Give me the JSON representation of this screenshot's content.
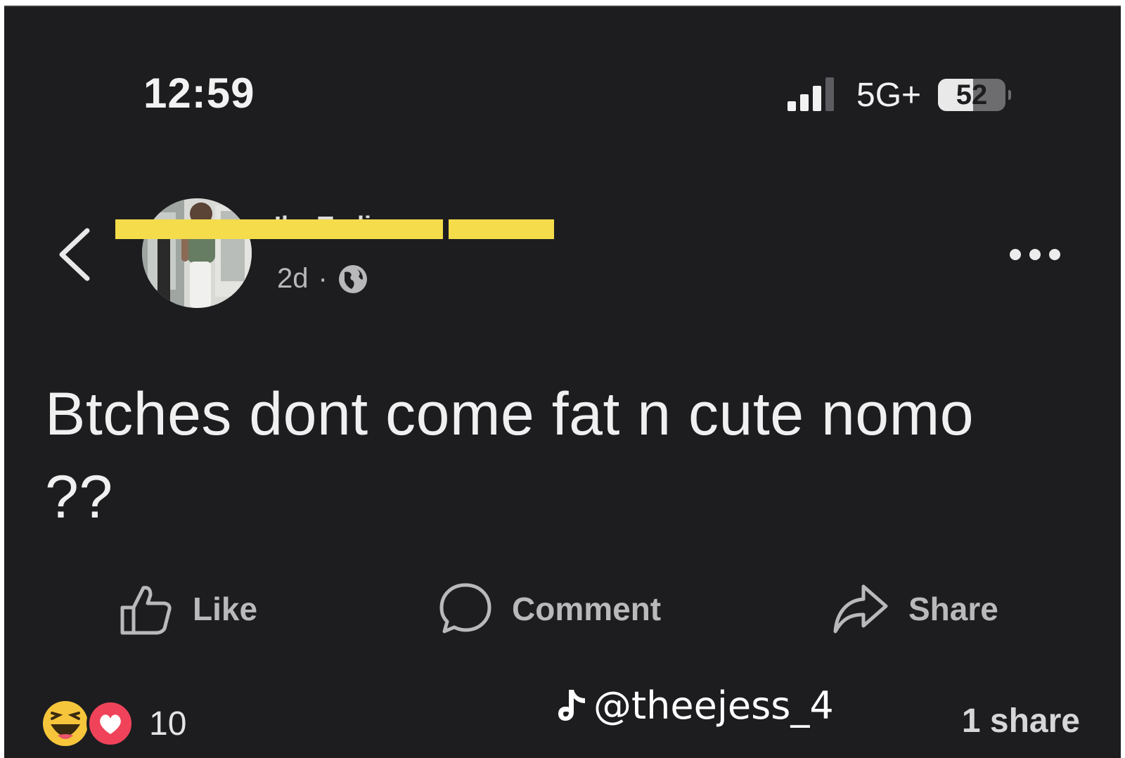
{
  "status_bar": {
    "time": "12:59",
    "network": "5G+",
    "battery_level": "52",
    "battery_fraction": 0.52,
    "signal_icon": "signal-bars-icon"
  },
  "post": {
    "author_name": "Ibe Trolin",
    "timestamp": "2d",
    "separator": "·",
    "audience_icon": "globe-icon",
    "text": "Btches dont come fat n cute nomo ??",
    "menu_icon": "more-dots-icon",
    "back_icon": "chevron-left-icon"
  },
  "actions": {
    "like_label": "Like",
    "comment_label": "Comment",
    "share_label": "Share"
  },
  "footer": {
    "reaction_icons": [
      "haha-emoji-icon",
      "love-heart-icon"
    ],
    "reaction_count": "10",
    "shares_text": "1 share"
  },
  "watermark": {
    "icon": "tiktok-logo-icon",
    "handle": "@theejess_4"
  },
  "colors": {
    "background": "#1d1d20",
    "text_primary": "#f0f0f0",
    "text_secondary": "#b8b8bb",
    "redaction": "#f4dc4a",
    "love_red": "#f0435a",
    "haha_yellow": "#f7c53b"
  }
}
